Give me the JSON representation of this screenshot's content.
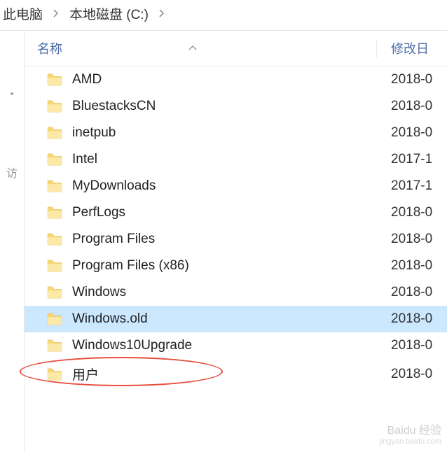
{
  "breadcrumb": {
    "items": [
      "此电脑",
      "本地磁盘 (C:)"
    ]
  },
  "sidebar": {
    "items": [
      "⋆",
      "访"
    ]
  },
  "headers": {
    "name": "名称",
    "date": "修改日"
  },
  "files": [
    {
      "name": "AMD",
      "date": "2018-0",
      "selected": false
    },
    {
      "name": "BluestacksCN",
      "date": "2018-0",
      "selected": false
    },
    {
      "name": "inetpub",
      "date": "2018-0",
      "selected": false
    },
    {
      "name": "Intel",
      "date": "2017-1",
      "selected": false
    },
    {
      "name": "MyDownloads",
      "date": "2017-1",
      "selected": false
    },
    {
      "name": "PerfLogs",
      "date": "2018-0",
      "selected": false
    },
    {
      "name": "Program Files",
      "date": "2018-0",
      "selected": false
    },
    {
      "name": "Program Files (x86)",
      "date": "2018-0",
      "selected": false
    },
    {
      "name": "Windows",
      "date": "2018-0",
      "selected": false
    },
    {
      "name": "Windows.old",
      "date": "2018-0",
      "selected": true
    },
    {
      "name": "Windows10Upgrade",
      "date": "2018-0",
      "selected": false
    },
    {
      "name": "用户",
      "date": "2018-0",
      "selected": false
    }
  ],
  "watermark": {
    "main": "Baidu 经验",
    "sub": "jingyan.baidu.com"
  }
}
